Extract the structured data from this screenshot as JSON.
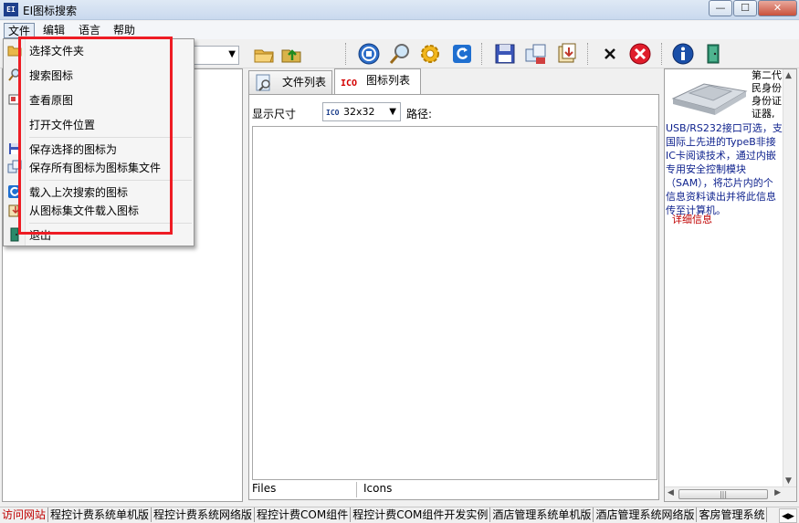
{
  "window": {
    "title": "EI图标搜索",
    "app_icon_text": "EI",
    "min_glyph": "—",
    "max_glyph": "☐",
    "close_glyph": "✕"
  },
  "menubar": {
    "items": [
      "文件",
      "编辑",
      "语言",
      "帮助"
    ]
  },
  "file_menu": {
    "items": [
      "选择文件夹",
      "搜索图标",
      "查看原图",
      "打开文件位置",
      "保存选择的图标为",
      "保存所有图标为图标集文件",
      "载入上次搜索的图标",
      "从图标集文件载入图标",
      "退出"
    ]
  },
  "tabs": {
    "files": "文件列表",
    "icons": "图标列表",
    "icons_glyph": "ICO"
  },
  "icon_panel": {
    "size_label": "显示尺寸",
    "size_value": "32x32",
    "size_glyph": "ICO",
    "path_label": "路径:",
    "status_files": "Files",
    "status_icons": "Icons"
  },
  "ad_panel": {
    "top_text": "第二代\n民身份\n身份证\n证器,",
    "body_text": "USB/RS232接口可选，支\n国际上先进的TypeB非接\nIC卡阅读技术，通过内嵌\n专用安全控制模块\n（SAM），将芯片内的个\n信息资料读出并将此信息\n传至计算机。",
    "detail_link": "详细信息",
    "scroll_up": "▲",
    "scroll_down": "▼",
    "scroll_left": "◀",
    "scroll_right": "▶",
    "scroll_grip": "|||"
  },
  "statusbar": {
    "links": [
      "访问网站",
      "程控计费系统单机版",
      "程控计费系统网络版",
      "程控计费COM组件",
      "程控计费COM组件开发实例",
      "酒店管理系统单机版",
      "酒店管理系统网络版",
      "客房管理系统"
    ],
    "scroll_glyph": "◀▶"
  },
  "colors": {
    "highlight": "#ee1c24",
    "link_active": "#c00000",
    "ad_text": "#0b1f8c"
  }
}
